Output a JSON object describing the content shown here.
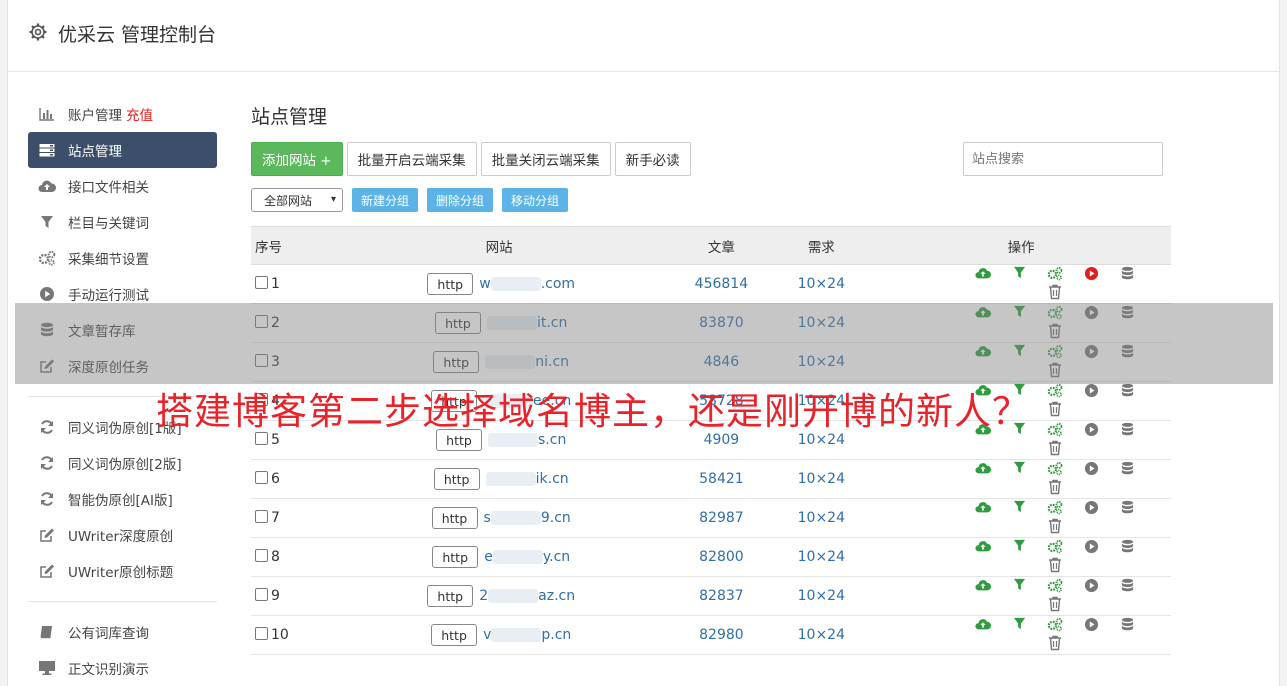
{
  "header": {
    "title": "优采云 管理控制台"
  },
  "sidebar": {
    "items": [
      {
        "label": "账户管理",
        "extra": "充值",
        "icon": "bar-chart-icon",
        "active": false
      },
      {
        "label": "站点管理",
        "icon": "server-icon",
        "active": true
      },
      {
        "label": "接口文件相关",
        "icon": "cloud-upload-icon",
        "active": false
      },
      {
        "label": "栏目与关键词",
        "icon": "filter-icon",
        "active": false
      },
      {
        "label": "采集细节设置",
        "icon": "gears-icon",
        "active": false
      },
      {
        "label": "手动运行测试",
        "icon": "play-circle-icon",
        "active": false
      },
      {
        "label": "文章暂存库",
        "icon": "database-icon",
        "active": false
      },
      {
        "label": "深度原创任务",
        "icon": "edit-icon",
        "active": false
      }
    ],
    "items2": [
      {
        "label": "同义词伪原创[1版]",
        "icon": "refresh-icon"
      },
      {
        "label": "同义词伪原创[2版]",
        "icon": "refresh-icon"
      },
      {
        "label": "智能伪原创[AI版]",
        "icon": "refresh-icon"
      },
      {
        "label": "UWriter深度原创",
        "icon": "edit-icon"
      },
      {
        "label": "UWriter原创标题",
        "icon": "edit-icon"
      }
    ],
    "items3": [
      {
        "label": "公有词库查询",
        "icon": "book-icon"
      },
      {
        "label": "正文识别演示",
        "icon": "monitor-icon"
      }
    ]
  },
  "main": {
    "title": "站点管理",
    "buttons": {
      "add": "添加网站 +",
      "batch_open": "批量开启云端采集",
      "batch_close": "批量关闭云端采集",
      "guide": "新手必读"
    },
    "search_placeholder": "站点搜索",
    "group_select": "全部网站",
    "group_buttons": {
      "new": "新建分组",
      "delete": "删除分组",
      "move": "移动分组"
    },
    "table": {
      "headers": [
        "序号",
        "网站",
        "文章",
        "需求",
        "操作"
      ],
      "http_label": "http",
      "rows": [
        {
          "no": "1",
          "domain_prefix": "w",
          "domain_suffix": ".com",
          "articles": "456814",
          "need": "10×24"
        },
        {
          "no": "2",
          "domain_prefix": "",
          "domain_suffix": "it.cn",
          "articles": "83870",
          "need": "10×24"
        },
        {
          "no": "3",
          "domain_prefix": "",
          "domain_suffix": "ni.cn",
          "articles": "4846",
          "need": "10×24"
        },
        {
          "no": "4",
          "domain_prefix": "",
          "domain_suffix": "ee.cn",
          "articles": "58728",
          "need": "10×24"
        },
        {
          "no": "5",
          "domain_prefix": "",
          "domain_suffix": "s.cn",
          "articles": "4909",
          "need": "10×24"
        },
        {
          "no": "6",
          "domain_prefix": "",
          "domain_suffix": "ik.cn",
          "articles": "58421",
          "need": "10×24"
        },
        {
          "no": "7",
          "domain_prefix": "s",
          "domain_suffix": "9.cn",
          "articles": "82987",
          "need": "10×24"
        },
        {
          "no": "8",
          "domain_prefix": "e",
          "domain_suffix": "y.cn",
          "articles": "82800",
          "need": "10×24"
        },
        {
          "no": "9",
          "domain_prefix": "2",
          "domain_suffix": "az.cn",
          "articles": "82837",
          "need": "10×24"
        },
        {
          "no": "10",
          "domain_prefix": "v",
          "domain_suffix": "p.cn",
          "articles": "82980",
          "need": "10×24"
        }
      ]
    }
  },
  "banner": {
    "text": "搭建博客第二步选择域名博主，还是刚开博的新人？"
  },
  "colors": {
    "accent_green": "#5cb85c",
    "link_blue": "#2f6fab",
    "active_nav": "#3d4e6a",
    "banner_red": "#e8232a",
    "run_red": "#e02020"
  }
}
